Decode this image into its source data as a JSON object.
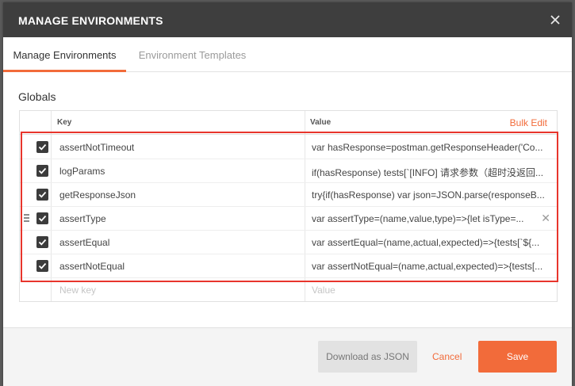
{
  "dialog": {
    "title": "MANAGE ENVIRONMENTS"
  },
  "tabs": [
    {
      "label": "Manage Environments",
      "active": true
    },
    {
      "label": "Environment Templates",
      "active": false
    }
  ],
  "section": {
    "title": "Globals"
  },
  "table": {
    "headers": {
      "key": "Key",
      "value": "Value"
    },
    "bulk_edit_label": "Bulk Edit",
    "rows": [
      {
        "checked": true,
        "key": "assertNotTimeout",
        "value": "var hasResponse=postman.getResponseHeader('Co..."
      },
      {
        "checked": true,
        "key": "logParams",
        "value": "if(hasResponse) tests[`[INFO] 请求参数（超时没返回..."
      },
      {
        "checked": true,
        "key": "getResponseJson",
        "value": "try{if(hasResponse) var json=JSON.parse(responseB..."
      },
      {
        "checked": true,
        "key": "assertType",
        "value": "var assertType=(name,value,type)=>{let isType=..."
      },
      {
        "checked": true,
        "key": "assertEqual",
        "value": "var assertEqual=(name,actual,expected)=>{tests[`${..."
      },
      {
        "checked": true,
        "key": "assertNotEqual",
        "value": "var assertNotEqual=(name,actual,expected)=>{tests[..."
      }
    ],
    "new_key_placeholder": "New key",
    "new_value_placeholder": "Value"
  },
  "footer": {
    "download_label": "Download as JSON",
    "cancel_label": "Cancel",
    "save_label": "Save"
  },
  "colors": {
    "accent": "#f26b3a",
    "titlebar": "#3e3e3e",
    "highlight_box": "#e8352c"
  }
}
